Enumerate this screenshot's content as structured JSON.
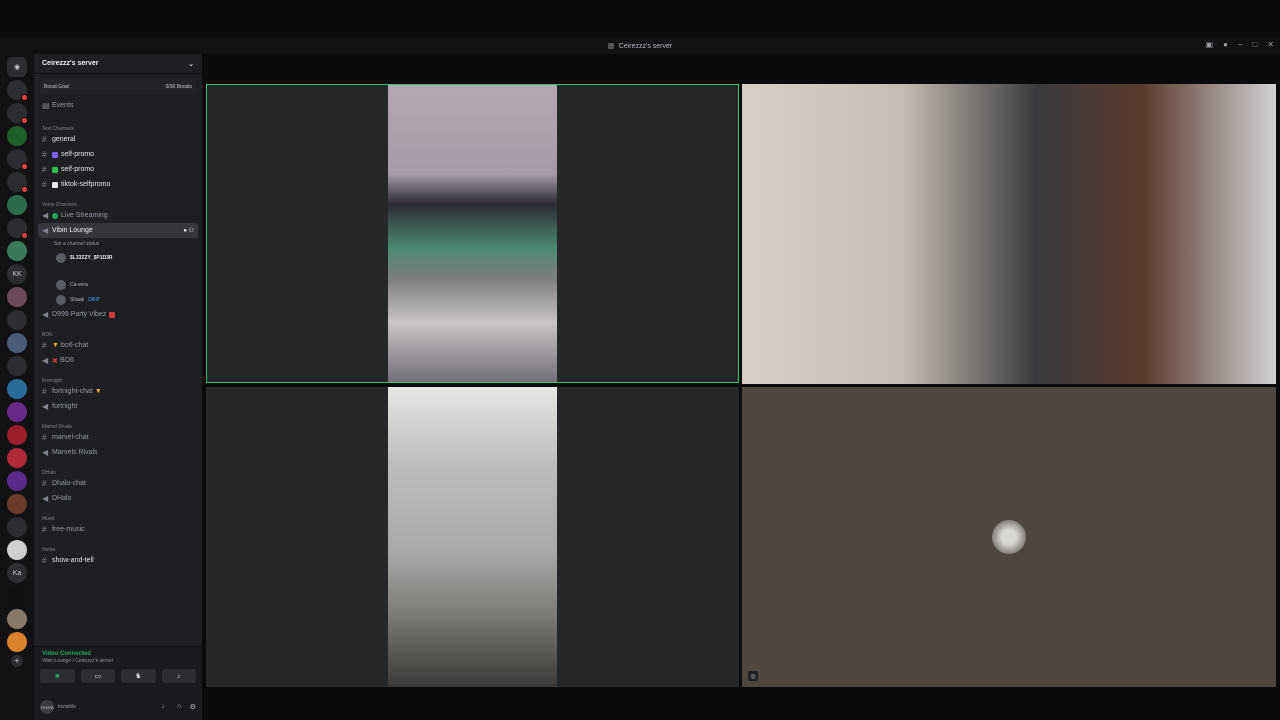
{
  "window": {
    "title": "Ceirezzz's server"
  },
  "server": {
    "name": "Ceirezzz's server",
    "boost_label": "Boost Goal",
    "boost_count": "0/30 Boosts"
  },
  "sidebar": {
    "events": "Events",
    "text_category": "Text Channels",
    "text_channels": [
      "general",
      "self-promo",
      "self-promo",
      "tiktok-selfpromo"
    ],
    "voice_category": "Voice Channels",
    "live_streaming": "Live Streaming",
    "vibin_lounge": "Vibin Lounge",
    "set_status": "Set a channel status",
    "voice_users": [
      "$L33ZZY_$P1D3R",
      "Ca-vera",
      "Shaak"
    ],
    "drip_tag": "DRIP",
    "party_vibes": "D999 Party Vibez",
    "bo6_cat": "BO6",
    "bo6_chat": "bo6-chat",
    "bo6": "BO6",
    "fortnight_cat": "Fortnight",
    "fortnight_chat": "fortnight-chat",
    "fortnight": "fortnight",
    "marvel_cat": "Marvel Rivals",
    "marvel_chat": "marvel-chat",
    "marvel": "Marvels Rivals",
    "dhalo_cat": "DHalo",
    "dhalo_chat": "Dhalo-chat",
    "dhalo": "DHalo",
    "music_cat": "Music",
    "free_music": "free-music",
    "herbs_cat": "Herbs",
    "show_and_tell": "show-and-tell"
  },
  "voice_panel": {
    "status": "Video Connected",
    "location": "Vibin Lounge / Ceirezzz's server"
  },
  "user_panel": {
    "name": "Invisible",
    "avatar_text": "YENTA"
  },
  "guilds": [
    "KK",
    "Ka"
  ],
  "colors": {
    "speaking": "#2dc770",
    "connected": "#23a55a"
  }
}
